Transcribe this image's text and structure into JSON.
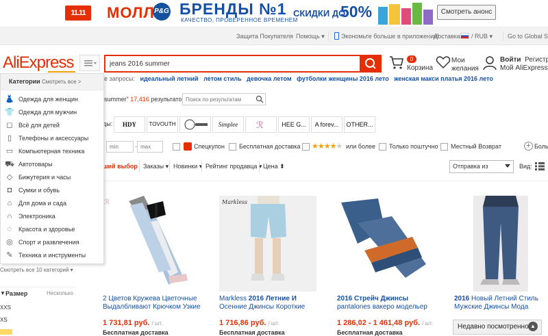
{
  "banner": {
    "mall_logo": "11.11",
    "mall_text": "МОЛЛ",
    "pg_logo": "P&G",
    "title": "БРЕНДЫ №1",
    "subtitle": "КАЧЕСТВО, ПРОВЕРЕННОЕ ВРЕМЕНЕМ",
    "discount_text": "СКИДКИ ДО",
    "discount_pct": "50%",
    "announce_button": "Смотреть анонс"
  },
  "topnav": {
    "items": [
      "Защита Покупателя",
      "Помощь ▾",
      "Экономьте больше в приложении!",
      "Доставка в",
      "/ RUB ▾",
      "Go to Global Site"
    ]
  },
  "header": {
    "logo": "AliExpress",
    "search_value": "jeans 2016 summer",
    "cart_count": "0",
    "cart_label": "Корзина",
    "wish_label": "Мои желания",
    "login_label": "Войти",
    "register_label": "Регистрация",
    "myali_label": "Мой AliExpress"
  },
  "popular": {
    "label": "е запросы:",
    "links": [
      "идеальный летний",
      "летом стиль",
      "девочка летом",
      "футболки женщины 2016 лето",
      "женская макси платья 2016 лето"
    ]
  },
  "categories": {
    "title": "Категории",
    "see_all": "Смотреть все >",
    "items": [
      {
        "label": "Одежда для женщин",
        "icon": "dress-icon",
        "glyph": "👗"
      },
      {
        "label": "Одежда для мужчин",
        "icon": "shirt-icon",
        "glyph": "👕"
      },
      {
        "label": "Всё для детей",
        "icon": "child-icon",
        "glyph": "◻"
      },
      {
        "label": "Телефоны и аксессуары",
        "icon": "phone-icon",
        "glyph": "▯"
      },
      {
        "label": "Компьютерная техника",
        "icon": "computer-icon",
        "glyph": "▭"
      },
      {
        "label": "Автотовары",
        "icon": "car-icon",
        "glyph": "⛟"
      },
      {
        "label": "Бижутерия и часы",
        "icon": "jewelry-icon",
        "glyph": "◇"
      },
      {
        "label": "Сумки и обувь",
        "icon": "bag-icon",
        "glyph": "◘"
      },
      {
        "label": "Для дома и сада",
        "icon": "home-icon",
        "glyph": "⌂"
      },
      {
        "label": "Электроника",
        "icon": "headphones-icon",
        "glyph": "∩"
      },
      {
        "label": "Красота и здоровье",
        "icon": "beauty-icon",
        "glyph": "◌"
      },
      {
        "label": "Спорт и развлечения",
        "icon": "sport-icon",
        "glyph": "◎"
      },
      {
        "label": "Техника и инструменты",
        "icon": "tools-icon",
        "glyph": "✎"
      }
    ]
  },
  "sidebar": {
    "more_cats": "Смотреть все 10 категорий ▾",
    "size_title": "Размер",
    "size_multi": "Несколько",
    "sizes": [
      "XXS",
      "XS"
    ]
  },
  "results": {
    "query_tail": "summer\"",
    "count": "17,416",
    "suffix": "результатов >",
    "in_results_placeholder": "Поиск по результатам"
  },
  "brands": {
    "label": "ды:",
    "items": [
      "HDY",
      "TOVOUTH",
      "",
      "Simplee",
      "",
      "HEE G...",
      "A forev...",
      "OTHER..."
    ]
  },
  "filters": {
    "min": "min",
    "max": "max",
    "coupon": "Спецкупон",
    "free_ship": "Бесплатная доставка",
    "rating": "или более",
    "single": "Только поштучно",
    "local": "Местный Возврат",
    "more": "Больше"
  },
  "sort": {
    "best": "ший выбор",
    "items": [
      "Заказы ▾",
      "Новинки ▾",
      "Рейтинг продавца ▾",
      "Цена ⬍"
    ],
    "ship_from": "Отправка из",
    "view_label": "Вид:"
  },
  "products": [
    {
      "title_pre": "2 Цветов Кружева Цветочные Выдалбливают Крючком Узкие",
      "title_bold": "",
      "price": "1 731,81 руб.",
      "unit": "/ шт.",
      "ship": "Бесплатная доставка"
    },
    {
      "title_pre": "Markless ",
      "title_bold": "2016 Летние И",
      "title_post": " Осенние Джинсы Короткие",
      "price": "1 716,86 руб.",
      "unit": "/ шт.",
      "ship": "Бесплатная доставка"
    },
    {
      "title_pre": "",
      "title_bold": "2016 Стрейч Джинсы",
      "title_post": " pantalones вакеро модельер",
      "price": "1 286,02 - 1 461,48 руб.",
      "unit": "/ шт.",
      "ship": "Бесплатная доставка"
    },
    {
      "title_pre": "",
      "title_bold": "2016",
      "title_post": " Новый Летний Стиль Мужские Джинсы Мода",
      "price": "",
      "unit": "",
      "ship": ""
    }
  ],
  "recent": "Недавно посмотренное"
}
